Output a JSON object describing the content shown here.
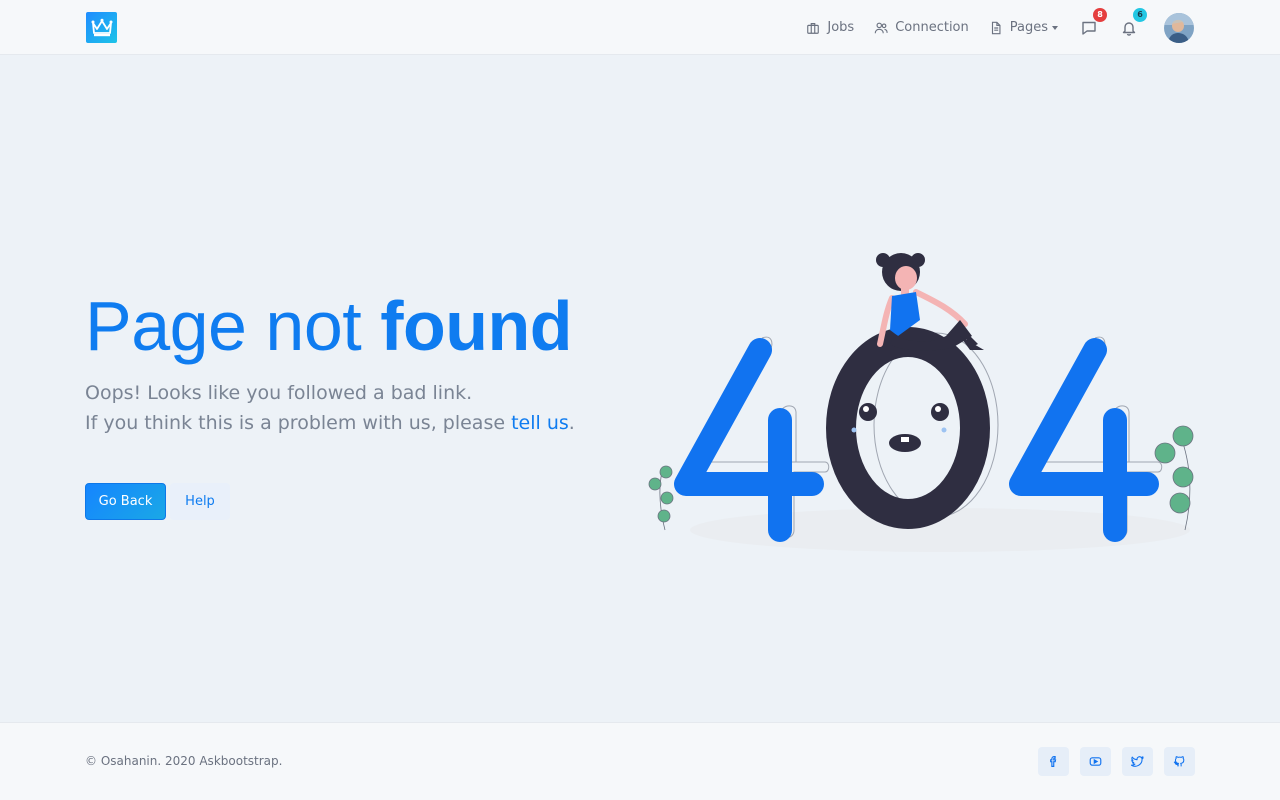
{
  "header": {
    "logo_icon": "crown-icon",
    "nav": {
      "jobs": "Jobs",
      "connection": "Connection",
      "pages": "Pages"
    },
    "messages_count": "8",
    "notifications_count": "6"
  },
  "main": {
    "title_light": "Page not ",
    "title_bold": "found",
    "message_line1": "Oops! Looks like you followed a bad link.",
    "message_line2_prefix": "If you think this is a problem with us, please ",
    "message_link": "tell us",
    "message_line2_suffix": ".",
    "go_back": "Go Back",
    "help": "Help",
    "illustration_text": "404"
  },
  "footer": {
    "copyright": "© Osahanin. 2020 Askbootstrap.",
    "socials": [
      "facebook-icon",
      "youtube-icon",
      "twitter-icon",
      "github-icon"
    ]
  },
  "colors": {
    "accent": "#0f7cf0",
    "dark": "#2f2e41",
    "leaf": "#5fb38a",
    "badge_red": "#e53e3e",
    "badge_cyan": "#22c7e3"
  }
}
